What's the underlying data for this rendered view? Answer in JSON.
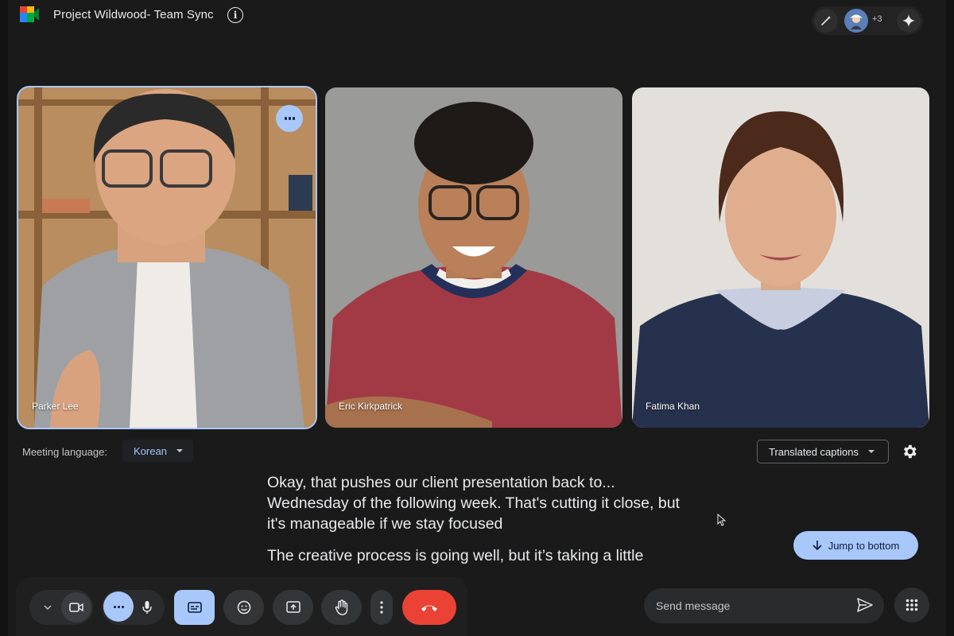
{
  "header": {
    "title": "Project Wildwood- Team Sync",
    "info_icon": "info-icon",
    "participant_overflow": "+3"
  },
  "participants": [
    {
      "name": "Parker Lee",
      "speaking": true
    },
    {
      "name": "Eric Kirkpatrick",
      "speaking": false
    },
    {
      "name": "Fatima Khan",
      "speaking": false
    }
  ],
  "language_bar": {
    "label": "Meeting language:",
    "selected_language": "Korean",
    "captions_mode": "Translated captions"
  },
  "captions": {
    "line1": "Okay, that pushes our client presentation back to...",
    "line2": "Wednesday of the following week. That's cutting it close, but",
    "line3": "it's manageable if we stay focused",
    "line4": "The creative process is going well, but it’s taking a little"
  },
  "jump": {
    "label": "Jump to bottom"
  },
  "chat": {
    "placeholder": "Send message"
  },
  "colors": {
    "accent": "#a8c7fa",
    "end_call": "#ea4335",
    "background": "#1a1a1a"
  }
}
